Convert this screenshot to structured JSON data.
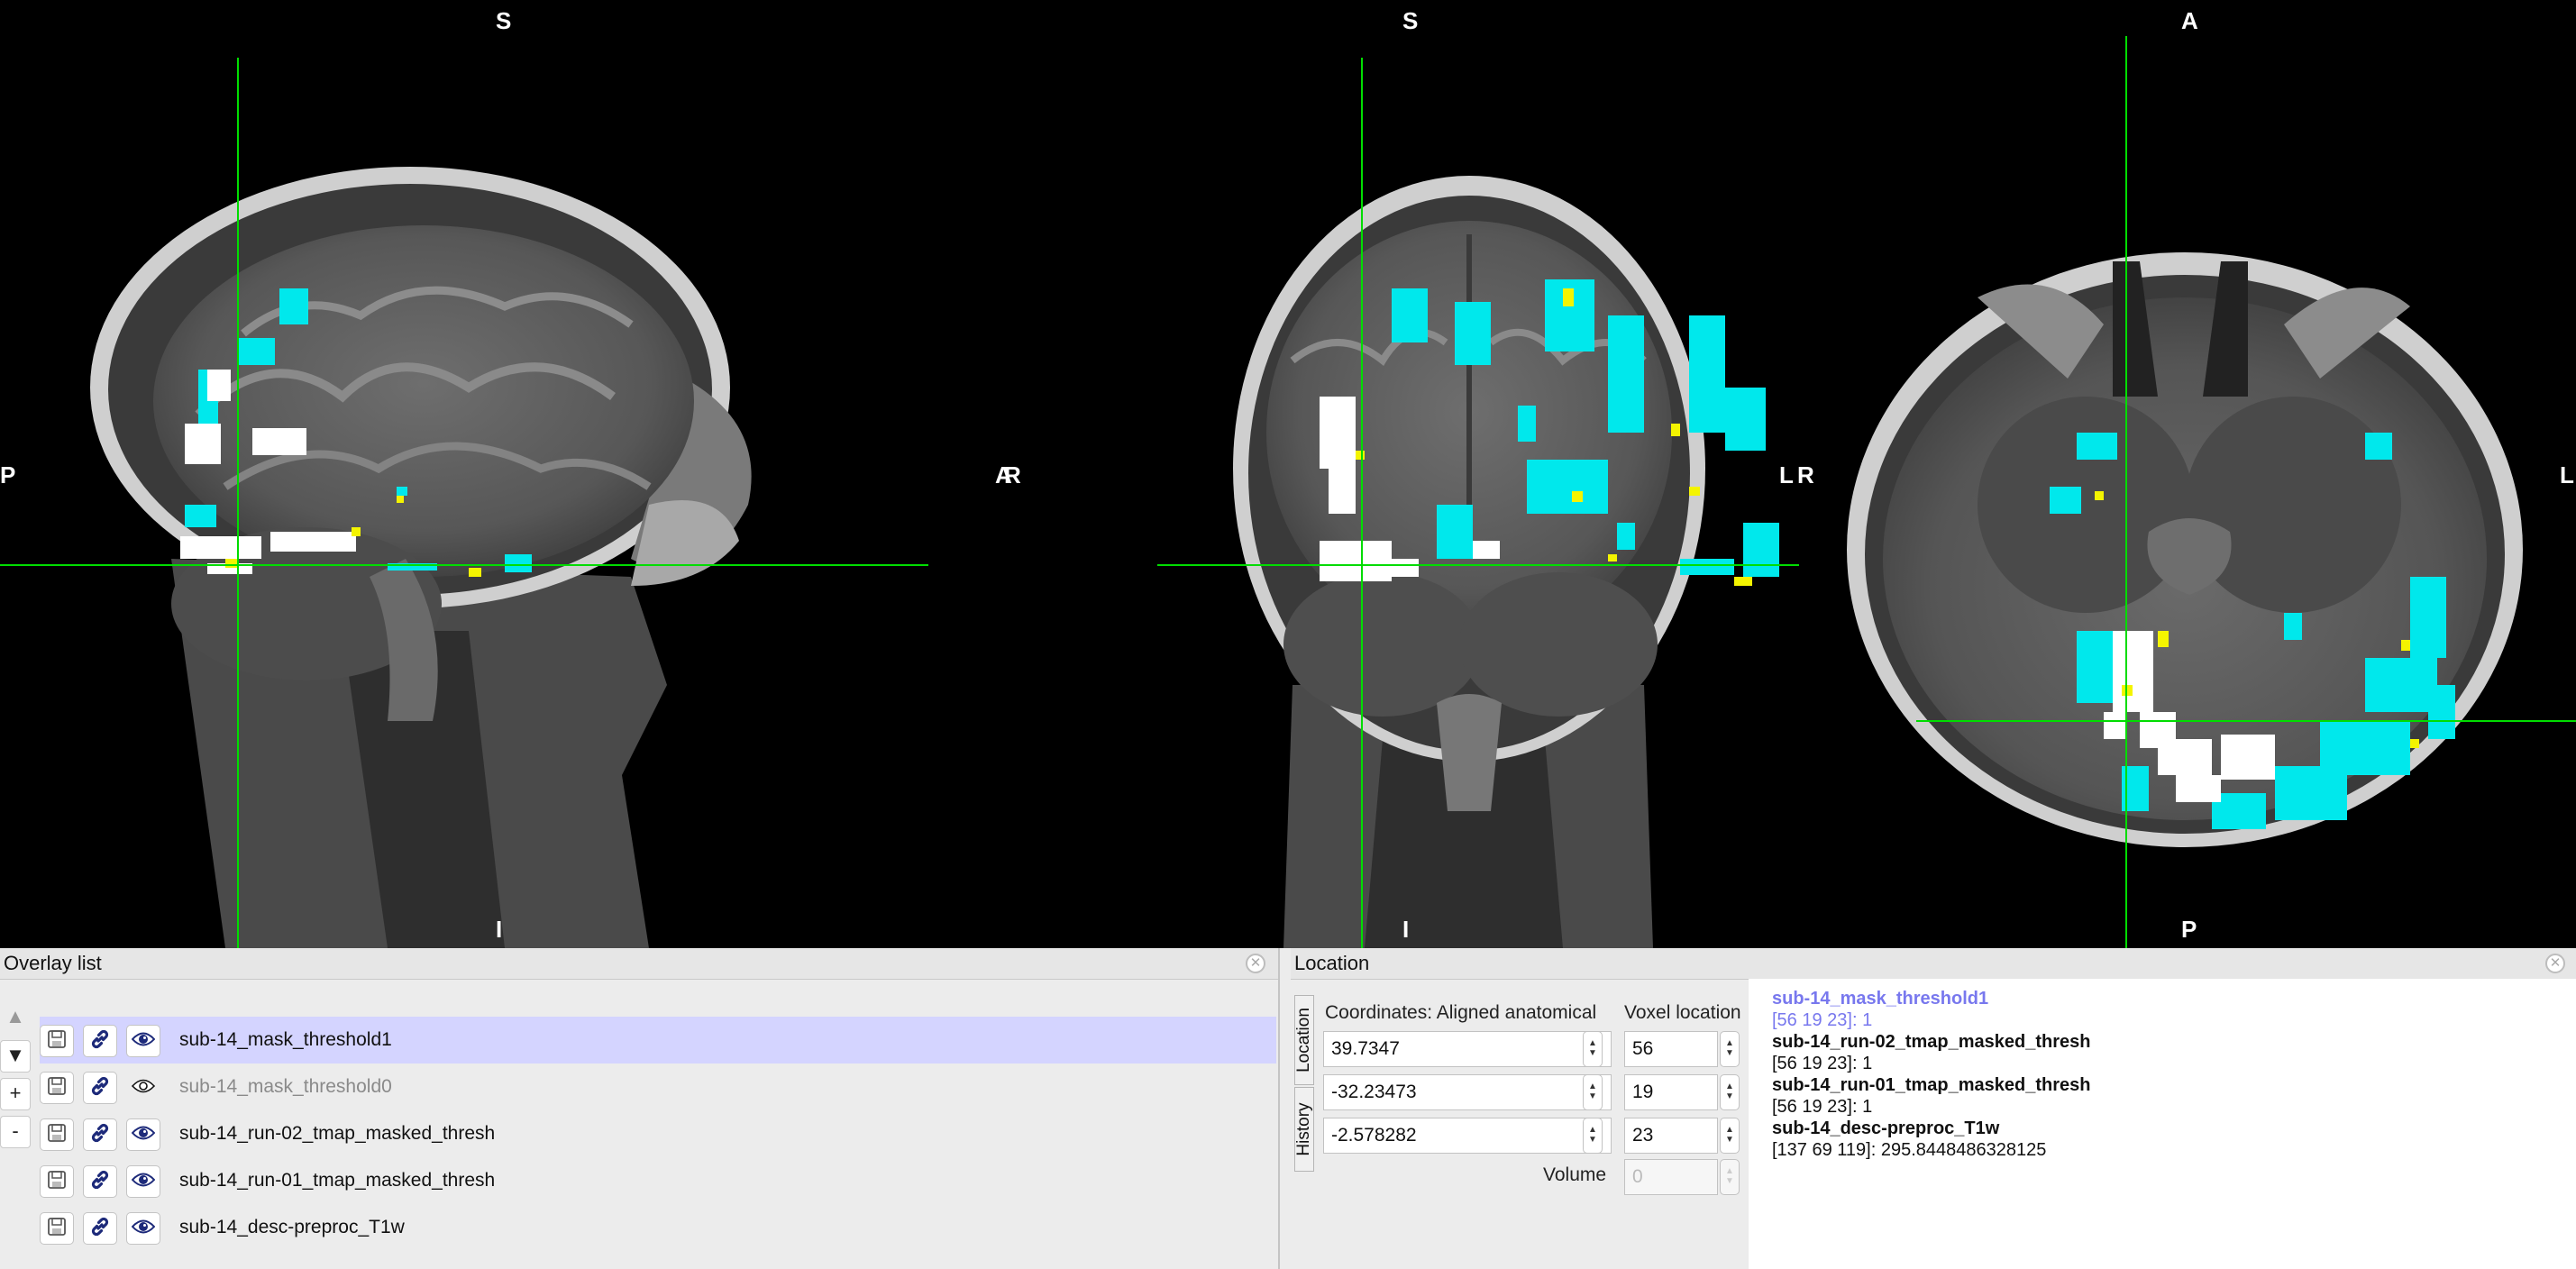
{
  "views": {
    "sagittal": {
      "top": "S",
      "bottom": "I",
      "left": "P",
      "right": "A"
    },
    "coronal": {
      "top": "S",
      "bottom": "I",
      "left": "R",
      "right": "L"
    },
    "axial": {
      "top": "A",
      "bottom": "P",
      "left": "R",
      "right": "L"
    }
  },
  "colors": {
    "crosshair": "#00dd00",
    "overlay_primary": "#00e8ec",
    "overlay_secondary": "#ffffff",
    "overlay_tertiary": "#f4f400",
    "selection": "#d4d4ff"
  },
  "overlay_list": {
    "title": "Overlay list",
    "controls": [
      "▲",
      "▼",
      "+",
      "-"
    ],
    "items": [
      {
        "name": "sub-14_mask_threshold1",
        "visible": true,
        "selected": true
      },
      {
        "name": "sub-14_mask_threshold0",
        "visible": false,
        "selected": false
      },
      {
        "name": "sub-14_run-02_tmap_masked_thresh",
        "visible": true,
        "selected": false
      },
      {
        "name": "sub-14_run-01_tmap_masked_thresh",
        "visible": true,
        "selected": false
      },
      {
        "name": "sub-14_desc-preproc_T1w",
        "visible": true,
        "selected": false
      }
    ],
    "icons": {
      "save": "save-icon",
      "link": "link-icon",
      "visibility": "eye-icon"
    }
  },
  "location": {
    "title": "Location",
    "tabs": [
      "Location",
      "History"
    ],
    "coordinates_label": "Coordinates: Aligned anatomical",
    "voxel_label": "Voxel location",
    "coords": [
      "39.7347",
      "-32.23473",
      "-2.578282"
    ],
    "voxels": [
      "56",
      "19",
      "23"
    ],
    "volume_label": "Volume",
    "volume_value": "0",
    "info": [
      {
        "text": "sub-14_mask_threshold1",
        "style": "hl b"
      },
      {
        "text": "[56 19 23]: 1",
        "style": "hl"
      },
      {
        "text": "sub-14_run-02_tmap_masked_thresh",
        "style": "b"
      },
      {
        "text": "[56 19 23]: 1",
        "style": ""
      },
      {
        "text": "sub-14_run-01_tmap_masked_thresh",
        "style": "b"
      },
      {
        "text": "[56 19 23]: 1",
        "style": ""
      },
      {
        "text": "sub-14_desc-preproc_T1w",
        "style": "b"
      },
      {
        "text": "[137 69 119]: 295.8448486328125",
        "style": ""
      }
    ]
  }
}
